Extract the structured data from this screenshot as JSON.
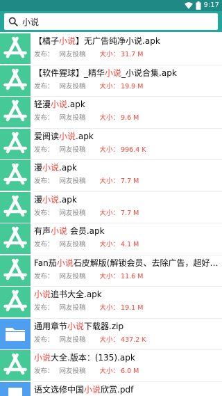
{
  "status": {
    "time": "9:17"
  },
  "search": {
    "query": "小说"
  },
  "labels": {
    "publish": "发布：",
    "size": "大小："
  },
  "items": [
    {
      "pre": "【橘子",
      "hl": "小说",
      "post": "】无广告纯净小说.apk",
      "source": "网友投稿",
      "size": "31.7 M",
      "icon": "app-store-icon"
    },
    {
      "pre": "【软件猩球】_精华",
      "hl": "小说",
      "post": "_小说合集.apk",
      "source": "网友投稿",
      "size": "19.9 M",
      "icon": "app-store-icon"
    },
    {
      "pre": "轻漫",
      "hl": "小说",
      "post": ".apk",
      "source": "网友投稿",
      "size": "9.6 M",
      "icon": "app-store-icon"
    },
    {
      "pre": "爱阅读",
      "hl": "小说",
      "post": ".apk",
      "source": "网友投稿",
      "size": "996.4 K",
      "icon": "app-store-icon"
    },
    {
      "pre": "漫",
      "hl": "小说",
      "post": ".apk",
      "source": "网友投稿",
      "size": "7.7 M",
      "icon": "app-store-icon"
    },
    {
      "pre": "漫",
      "hl": "小说",
      "post": ".apk",
      "source": "网友投稿",
      "size": "7.7 M",
      "icon": "app-store-icon"
    },
    {
      "pre": "有声",
      "hl": "小说",
      "post": " 会员.apk",
      "source": "网友投稿",
      "size": "4.1 M",
      "icon": "app-store-icon"
    },
    {
      "pre": "Fan茄",
      "hl": "小说",
      "post": "石皮解版(解锁会员、去除广告，超好用能听、...",
      "source": "网友投稿",
      "size": "11.6 M",
      "icon": "app-store-icon"
    },
    {
      "pre": "",
      "hl": "小说",
      "post": "追书大全.apk",
      "source": "网友投稿",
      "size": "19.1 M",
      "icon": "app-store-icon"
    },
    {
      "pre": "通用章节",
      "hl": "小说",
      "post": "下载器.zip",
      "source": "网友投稿",
      "size": "437.2 K",
      "icon": "folder-icon"
    },
    {
      "pre": "",
      "hl": "小说",
      "post": "大全.版本：(135).apk",
      "source": "网友投稿",
      "size": "6.0 M",
      "icon": "app-store-icon"
    },
    {
      "pre": "语文选修中国",
      "hl": "小说",
      "post": "欣赏.pdf",
      "source": "",
      "size": "",
      "icon": "document-icon"
    }
  ]
}
